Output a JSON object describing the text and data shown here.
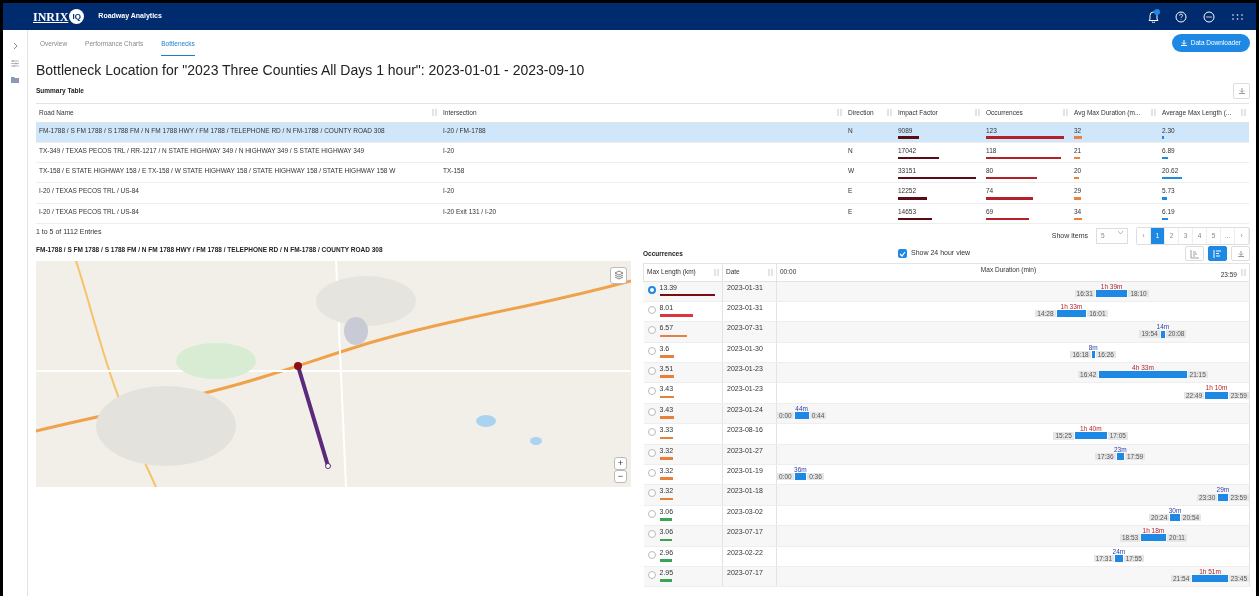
{
  "app": {
    "logo": "INRIX",
    "logo_badge": "IQ",
    "product": "Roadway Analytics"
  },
  "tabs": [
    {
      "label": "Overview",
      "selected": false
    },
    {
      "label": "Performance Charts",
      "selected": false
    },
    {
      "label": "Bottlenecks",
      "selected": true
    }
  ],
  "download_button": "Data Downloader",
  "title": "Bottleneck Location for \"2023 Three Counties All Days 1 hour\": 2023-01-01 - 2023-09-10",
  "summary": {
    "heading": "Summary Table",
    "columns": [
      {
        "label": "Road Name"
      },
      {
        "label": "Intersection"
      },
      {
        "label": "Direction"
      },
      {
        "label": "Impact Factor",
        "color": "#5a0b16"
      },
      {
        "label": "Occurrences",
        "color": "#b3202a"
      },
      {
        "label": "Avg Max Duration (m...",
        "color": "#e8823f"
      },
      {
        "label": "Average Max Length (...",
        "color": "#1e88e5"
      }
    ],
    "rows": [
      {
        "selected": true,
        "road": "FM-1788 / S FM 1788 / S 1788 FM / N FM 1788 HWY / FM 1788 / TELEPHONE RD / N FM-1788 / COUNTY ROAD 308",
        "intersection": "I-20 / FM-1788",
        "direction": "N",
        "metrics": [
          {
            "value": "9089",
            "level": 0.26
          },
          {
            "value": "123",
            "level": 0.95
          },
          {
            "value": "32",
            "level": 0.1
          },
          {
            "value": "2.30",
            "level": 0.02
          }
        ]
      },
      {
        "selected": false,
        "road": "TX-349 / TEXAS PECOS TRL / RR-1217 / N STATE HIGHWAY 349 / N HIGHWAY 349 / S STATE HIGHWAY 349",
        "intersection": "I-20",
        "direction": "N",
        "metrics": [
          {
            "value": "17042",
            "level": 0.5
          },
          {
            "value": "118",
            "level": 0.91
          },
          {
            "value": "21",
            "level": 0.07
          },
          {
            "value": "6.89",
            "level": 0.07
          }
        ]
      },
      {
        "selected": false,
        "road": "TX-158 / E STATE HIGHWAY 158 / E TX-158 / W STATE HIGHWAY 158 / STATE HIGHWAY 158 / STATE HIGHWAY 158 W",
        "intersection": "TX-158",
        "direction": "W",
        "metrics": [
          {
            "value": "33151",
            "level": 0.95
          },
          {
            "value": "80",
            "level": 0.62
          },
          {
            "value": "20",
            "level": 0.06
          },
          {
            "value": "20.62",
            "level": 0.24
          }
        ]
      },
      {
        "selected": false,
        "road": "I-20 / TEXAS PECOS TRL / US-84",
        "intersection": "I-20",
        "direction": "E",
        "metrics": [
          {
            "value": "12252",
            "level": 0.35
          },
          {
            "value": "74",
            "level": 0.57
          },
          {
            "value": "29",
            "level": 0.09
          },
          {
            "value": "5.73",
            "level": 0.06
          }
        ]
      },
      {
        "selected": false,
        "road": "I-20 / TEXAS PECOS TRL / US-84",
        "intersection": "I-20 Exit 131 / I-20",
        "direction": "E",
        "metrics": [
          {
            "value": "14653",
            "level": 0.42
          },
          {
            "value": "69",
            "level": 0.53
          },
          {
            "value": "34",
            "level": 0.1
          },
          {
            "value": "6.19",
            "level": 0.07
          }
        ]
      }
    ],
    "entries": "1 to 5 of 1112 Entries",
    "show_items_label": "Show items",
    "show_items_value": "5",
    "pages": [
      {
        "label": "‹",
        "selected": false
      },
      {
        "label": "1",
        "selected": true
      },
      {
        "label": "2",
        "selected": false
      },
      {
        "label": "3",
        "selected": false
      },
      {
        "label": "4",
        "selected": false
      },
      {
        "label": "5",
        "selected": false
      },
      {
        "label": "...",
        "selected": false
      },
      {
        "label": "›",
        "selected": false
      }
    ]
  },
  "map": {
    "heading": "FM-1788 / S FM 1788 / S 1788 FM / N FM 1788 HWY / FM 1788 / TELEPHONE RD / N FM-1788 / COUNTY ROAD 308",
    "zoom_in": "+",
    "zoom_out": "−"
  },
  "occurrences": {
    "heading": "Occurrences",
    "show_24h": {
      "label": "Show 24 hour view",
      "checked": true
    },
    "views": [
      {
        "selected": false
      },
      {
        "selected": true
      }
    ],
    "columns": {
      "length": "Max Length (km)",
      "date": "Date",
      "duration": "Max Duration (min)",
      "start": "00:00",
      "end": "23:59"
    },
    "rows": [
      {
        "selected": true,
        "length": "13.39",
        "color": "#7b0c10",
        "date": "2023-01-31",
        "start": "16:31",
        "end": "18:10",
        "duration": "1h 39m",
        "over_hour": true
      },
      {
        "selected": false,
        "length": "8.01",
        "color": "#d9363e",
        "date": "2023-01-31",
        "start": "14:28",
        "end": "16:01",
        "duration": "1h 33m",
        "over_hour": true
      },
      {
        "selected": false,
        "length": "6.57",
        "color": "#e8803a",
        "date": "2023-07-31",
        "start": "19:54",
        "end": "20:08",
        "duration": "14m",
        "over_hour": false
      },
      {
        "selected": false,
        "length": "3.6",
        "color": "#e8803a",
        "date": "2023-01-30",
        "start": "16:18",
        "end": "16:26",
        "duration": "8m",
        "over_hour": false
      },
      {
        "selected": false,
        "length": "3.51",
        "color": "#e8803a",
        "date": "2023-01-23",
        "start": "16:42",
        "end": "21:15",
        "duration": "4h 33m",
        "over_hour": true
      },
      {
        "selected": false,
        "length": "3.43",
        "color": "#e8803a",
        "date": "2023-01-23",
        "start": "22:49",
        "end": "23:59",
        "duration": "1h 10m",
        "over_hour": true
      },
      {
        "selected": false,
        "length": "3.43",
        "color": "#e8803a",
        "date": "2023-01-24",
        "start": "0:00",
        "end": "0:44",
        "duration": "44m",
        "over_hour": false
      },
      {
        "selected": false,
        "length": "3.33",
        "color": "#e8803a",
        "date": "2023-08-16",
        "start": "15:25",
        "end": "17:05",
        "duration": "1h 40m",
        "over_hour": true
      },
      {
        "selected": false,
        "length": "3.32",
        "color": "#e8803a",
        "date": "2023-01-27",
        "start": "17:36",
        "end": "17:59",
        "duration": "23m",
        "over_hour": false
      },
      {
        "selected": false,
        "length": "3.32",
        "color": "#e8803a",
        "date": "2023-01-19",
        "start": "0:00",
        "end": "0:36",
        "duration": "36m",
        "over_hour": false
      },
      {
        "selected": false,
        "length": "3.32",
        "color": "#e8803a",
        "date": "2023-01-18",
        "start": "23:30",
        "end": "23:59",
        "duration": "29m",
        "over_hour": false
      },
      {
        "selected": false,
        "length": "3.06",
        "color": "#3aa655",
        "date": "2023-03-02",
        "start": "20:24",
        "end": "20:54",
        "duration": "30m",
        "over_hour": false
      },
      {
        "selected": false,
        "length": "3.06",
        "color": "#3aa655",
        "date": "2023-07-17",
        "start": "18:53",
        "end": "20:11",
        "duration": "1h 18m",
        "over_hour": true
      },
      {
        "selected": false,
        "length": "2.96",
        "color": "#3aa655",
        "date": "2023-02-22",
        "start": "17:31",
        "end": "17:55",
        "duration": "24m",
        "over_hour": false
      },
      {
        "selected": false,
        "length": "2.95",
        "color": "#3aa655",
        "date": "2023-07-17",
        "start": "21:54",
        "end": "23:45",
        "duration": "1h 51m",
        "over_hour": true
      }
    ]
  }
}
